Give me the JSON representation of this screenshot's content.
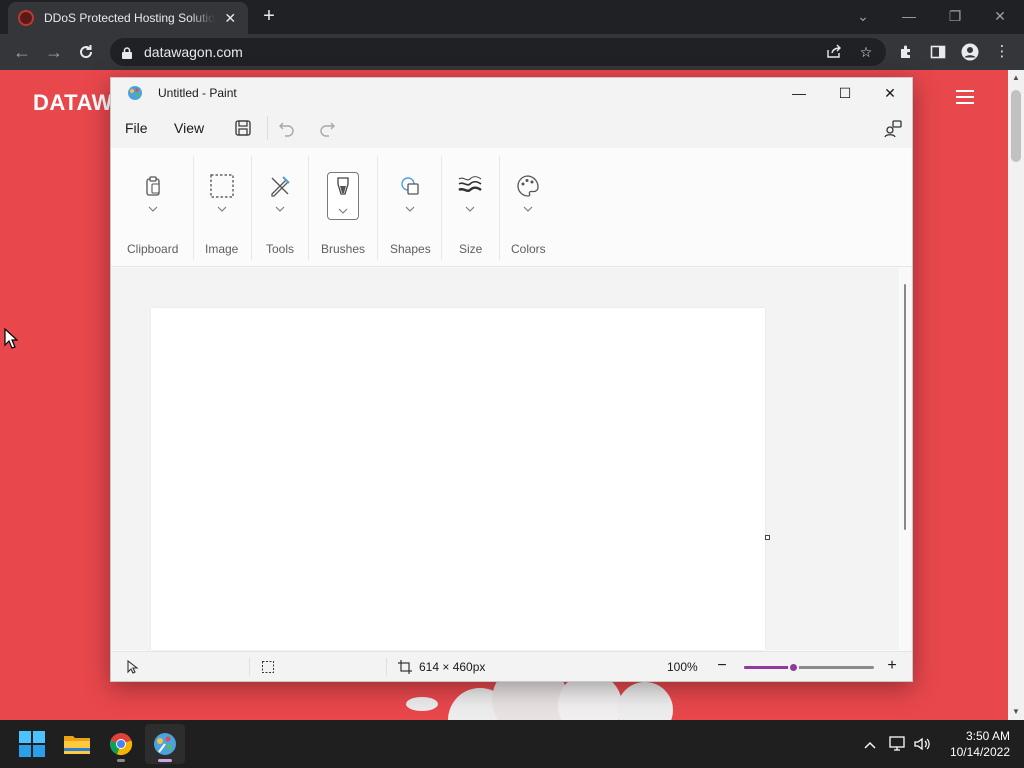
{
  "browser": {
    "tab": {
      "title": "DDoS Protected Hosting Solutions",
      "close": "✕"
    },
    "new_tab": "+",
    "url": "datawagon.com",
    "window_controls": {
      "tab_search": "⌄",
      "minimize": "—",
      "restore": "❐",
      "close": "✕"
    }
  },
  "site": {
    "logo_text": "DATAW"
  },
  "paint": {
    "title": "Untitled - Paint",
    "controls": {
      "minimize": "—",
      "maximize": "☐",
      "close": "✕"
    },
    "menu": {
      "file": "File",
      "view": "View"
    },
    "ribbon": {
      "clipboard": "Clipboard",
      "image": "Image",
      "tools": "Tools",
      "brushes": "Brushes",
      "shapes": "Shapes",
      "size": "Size",
      "colors": "Colors"
    },
    "status": {
      "canvas_size": "614 × 460px",
      "zoom": "100%",
      "zoom_level_percent": 100,
      "zoom_out": "−",
      "zoom_in": "+"
    }
  },
  "taskbar": {
    "apps": [
      "start-icon",
      "file-explorer-icon",
      "chrome-icon",
      "paint-icon"
    ],
    "time": "3:50 AM",
    "date": "10/14/2022"
  },
  "colors": {
    "site_background": "#e8474c",
    "zoom_accent": "#8e3a9e",
    "browser_dark": "#202124"
  }
}
